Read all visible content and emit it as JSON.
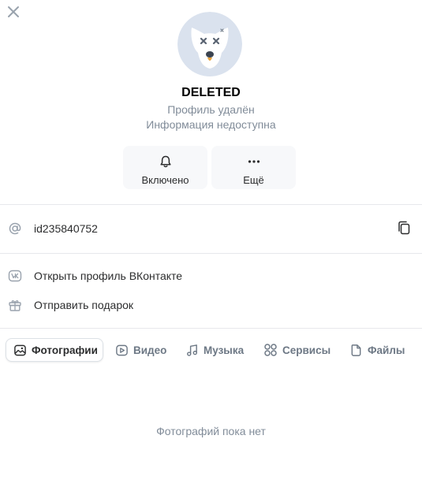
{
  "profile": {
    "name": "DELETED",
    "status_line1": "Профиль удалён",
    "status_line2": "Информация недоступна"
  },
  "actions": [
    {
      "label": "Включено",
      "icon": "bell-icon"
    },
    {
      "label": "Ещё",
      "icon": "more-dots-icon"
    }
  ],
  "info": {
    "user_id": "id235840752"
  },
  "links": [
    {
      "label": "Открыть профиль ВКонтакте",
      "icon": "vk-logo-icon"
    },
    {
      "label": "Отправить подарок",
      "icon": "gift-icon"
    }
  ],
  "tabs": [
    {
      "label": "Фотографии",
      "icon": "image-icon",
      "active": true
    },
    {
      "label": "Видео",
      "icon": "video-icon",
      "active": false
    },
    {
      "label": "Музыка",
      "icon": "music-note-icon",
      "active": false
    },
    {
      "label": "Сервисы",
      "icon": "services-grid-icon",
      "active": false
    },
    {
      "label": "Файлы",
      "icon": "file-icon",
      "active": false
    }
  ],
  "empty_state": "Фотографий пока нет",
  "colors": {
    "accent": "#2c2d2e",
    "secondary_text": "#818c99",
    "icon": "#99a2ad",
    "button_bg": "#f7f8fa",
    "divider": "#e7e8ec",
    "avatar_bg": "#dae2ee"
  }
}
